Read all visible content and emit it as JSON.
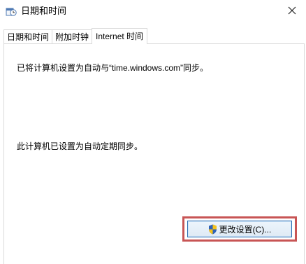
{
  "window": {
    "title": "日期和时间"
  },
  "icons": {
    "app": "date-time-icon",
    "close": "close-icon",
    "shield": "shield-icon"
  },
  "tabs": [
    {
      "label": "日期和时间",
      "active": false
    },
    {
      "label": "附加时钟",
      "active": false
    },
    {
      "label": "Internet 时间",
      "active": true
    }
  ],
  "internet_time": {
    "status_line": "已将计算机设置为自动与“time.windows.com”同步。",
    "schedule_line": "此计算机已设置为自动定期同步。",
    "change_settings_label": "更改设置(C)..."
  },
  "colors": {
    "highlight": "#c85555",
    "button_border": "#2f6fb3"
  }
}
